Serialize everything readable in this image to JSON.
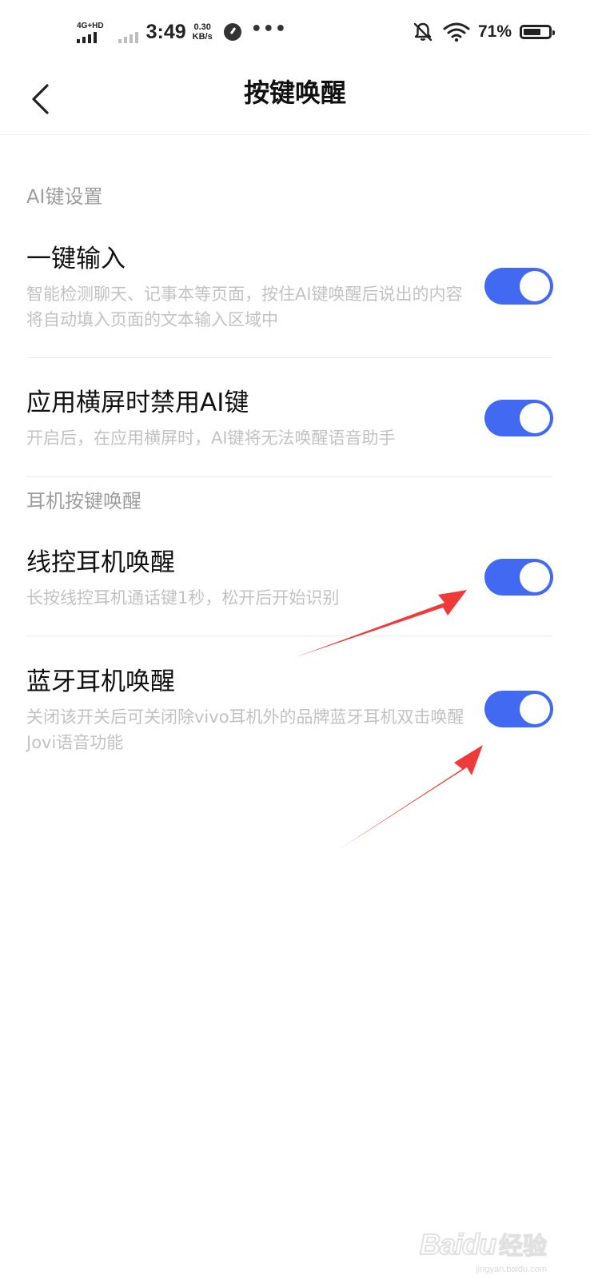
{
  "status_bar": {
    "network_label": "4G+HD",
    "time": "3:49",
    "speed_value": "0.30",
    "speed_unit": "KB/s",
    "more": "•••",
    "battery_pct": "71%",
    "battery_level": 0.71
  },
  "header": {
    "title": "按键唤醒"
  },
  "sections": [
    {
      "title": "AI键设置",
      "items": [
        {
          "title": "一键输入",
          "desc": "智能检测聊天、记事本等页面，按住AI键唤醒后说出的内容将自动填入页面的文本输入区域中",
          "enabled": true
        },
        {
          "title": "应用横屏时禁用AI键",
          "desc": "开启后，在应用横屏时，AI键将无法唤醒语音助手",
          "enabled": true
        }
      ]
    },
    {
      "title": "耳机按键唤醒",
      "items": [
        {
          "title": "线控耳机唤醒",
          "desc": "长按线控耳机通话键1秒，松开后开始识别",
          "enabled": true
        },
        {
          "title": "蓝牙耳机唤醒",
          "desc": "关闭该开关后可关闭除vivo耳机外的品牌蓝牙耳机双击唤醒Jovi语音功能",
          "enabled": true
        }
      ]
    }
  ],
  "colors": {
    "toggle_on": "#4169f2",
    "annotation_arrow": "#f03a3a"
  },
  "watermark": {
    "brand": "Baidu",
    "suffix": "经验",
    "url": "jingyan.baidu.com"
  }
}
